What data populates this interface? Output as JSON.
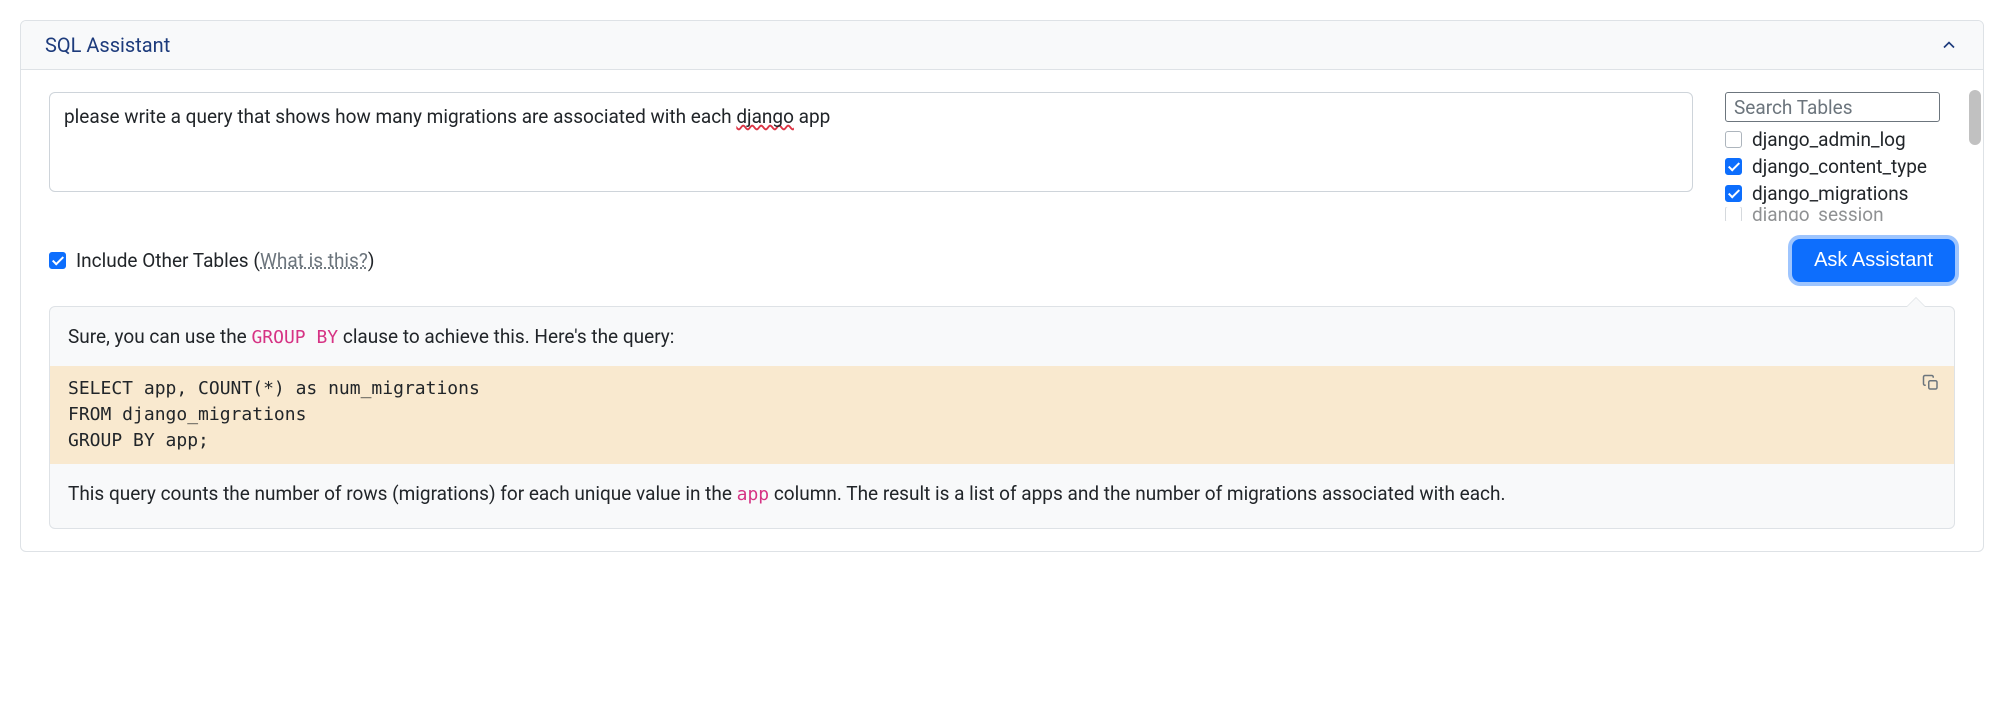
{
  "panel": {
    "title": "SQL Assistant"
  },
  "prompt": {
    "text_pre": "please write a query that shows how many migrations are associated with each ",
    "text_underlined": "django",
    "text_post": " app"
  },
  "search": {
    "placeholder": "Search Tables"
  },
  "tables": [
    {
      "name": "django_admin_log",
      "checked": false
    },
    {
      "name": "django_content_type",
      "checked": true
    },
    {
      "name": "django_migrations",
      "checked": true
    },
    {
      "name": "django_session",
      "checked": false
    }
  ],
  "options": {
    "include_other_label": "Include Other Tables",
    "what_is_this": "What is this?",
    "include_other_checked": true
  },
  "buttons": {
    "ask": "Ask Assistant"
  },
  "response": {
    "line1_pre": "Sure, you can use the ",
    "line1_code": "GROUP BY",
    "line1_post": " clause to achieve this. Here's the query:",
    "sql": "SELECT app, COUNT(*) as num_migrations\nFROM django_migrations\nGROUP BY app;",
    "line2_pre": "This query counts the number of rows (migrations) for each unique value in the ",
    "line2_code": "app",
    "line2_post": " column. The result is a list of apps and the number of migrations associated with each."
  }
}
